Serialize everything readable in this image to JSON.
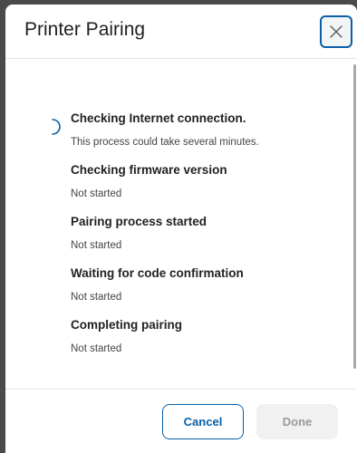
{
  "dialog": {
    "title": "Printer Pairing",
    "close_icon": "close-icon"
  },
  "steps": [
    {
      "title": "Checking Internet connection.",
      "status": "This process could take several minutes.",
      "state": "in-progress",
      "icon": "loading-spinner-icon"
    },
    {
      "title": "Checking firmware version",
      "status": "Not started",
      "state": "not-started"
    },
    {
      "title": "Pairing process started",
      "status": "Not started",
      "state": "not-started"
    },
    {
      "title": "Waiting for code confirmation",
      "status": "Not started",
      "state": "not-started"
    },
    {
      "title": "Completing pairing",
      "status": "Not started",
      "state": "not-started"
    }
  ],
  "footer": {
    "cancel_label": "Cancel",
    "done_label": "Done",
    "done_enabled": false
  },
  "colors": {
    "accent": "#0a5ea8",
    "disabled_bg": "#f1f1f1",
    "disabled_text": "#9a9a9a"
  }
}
